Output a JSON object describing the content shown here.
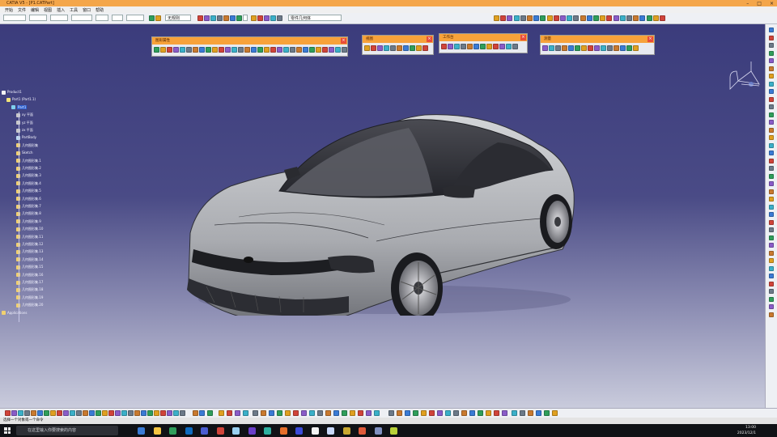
{
  "window": {
    "title": "CATIA V5 - [P1.CATPart]",
    "buttons": [
      "–",
      "□",
      "×"
    ]
  },
  "menu": [
    "开始",
    "文件",
    "编辑",
    "视图",
    "插入",
    "工具",
    "窗口",
    "帮助"
  ],
  "toolbar_top": {
    "combo_values": [
      "",
      "",
      "",
      "",
      "",
      "",
      "",
      "",
      "无规则",
      "零件几何体"
    ]
  },
  "floating_toolbars": [
    {
      "title": "图形属性"
    },
    {
      "title": "视图"
    },
    {
      "title": "工作台"
    },
    {
      "title": "测量"
    }
  ],
  "tree": {
    "nodes": [
      "Product1",
      "Part1 (Part1.1)",
      "Part1",
      "xy 平面",
      "yz 平面",
      "zx 平面",
      "PartBody",
      "几何图形集",
      "Sketch",
      "几何图形集.1",
      "几何图形集.2",
      "几何图形集.3",
      "几何图形集.4",
      "几何图形集.5",
      "几何图形集.6",
      "几何图形集.7",
      "几何图形集.8",
      "几何图形集.9",
      "几何图形集.10",
      "几何图形集.11",
      "几何图形集.12",
      "几何图形集.13",
      "几何图形集.14",
      "几何图形集.15",
      "几何图形集.16",
      "几何图形集.17",
      "几何图形集.18",
      "几何图形集.19",
      "几何图形集.20",
      "Applications"
    ]
  },
  "status": {
    "text": "选择一个对象或一个命令"
  },
  "taskbar": {
    "search_placeholder": "在这里输入你要搜索的内容",
    "time": "13:00",
    "date": "2023/12/1"
  },
  "colors": {
    "title_orange": "#f4a64a",
    "viewport_top": "#3b3c7c",
    "viewport_bottom": "#c9cbdc",
    "car_body": "#b9bbbe"
  }
}
